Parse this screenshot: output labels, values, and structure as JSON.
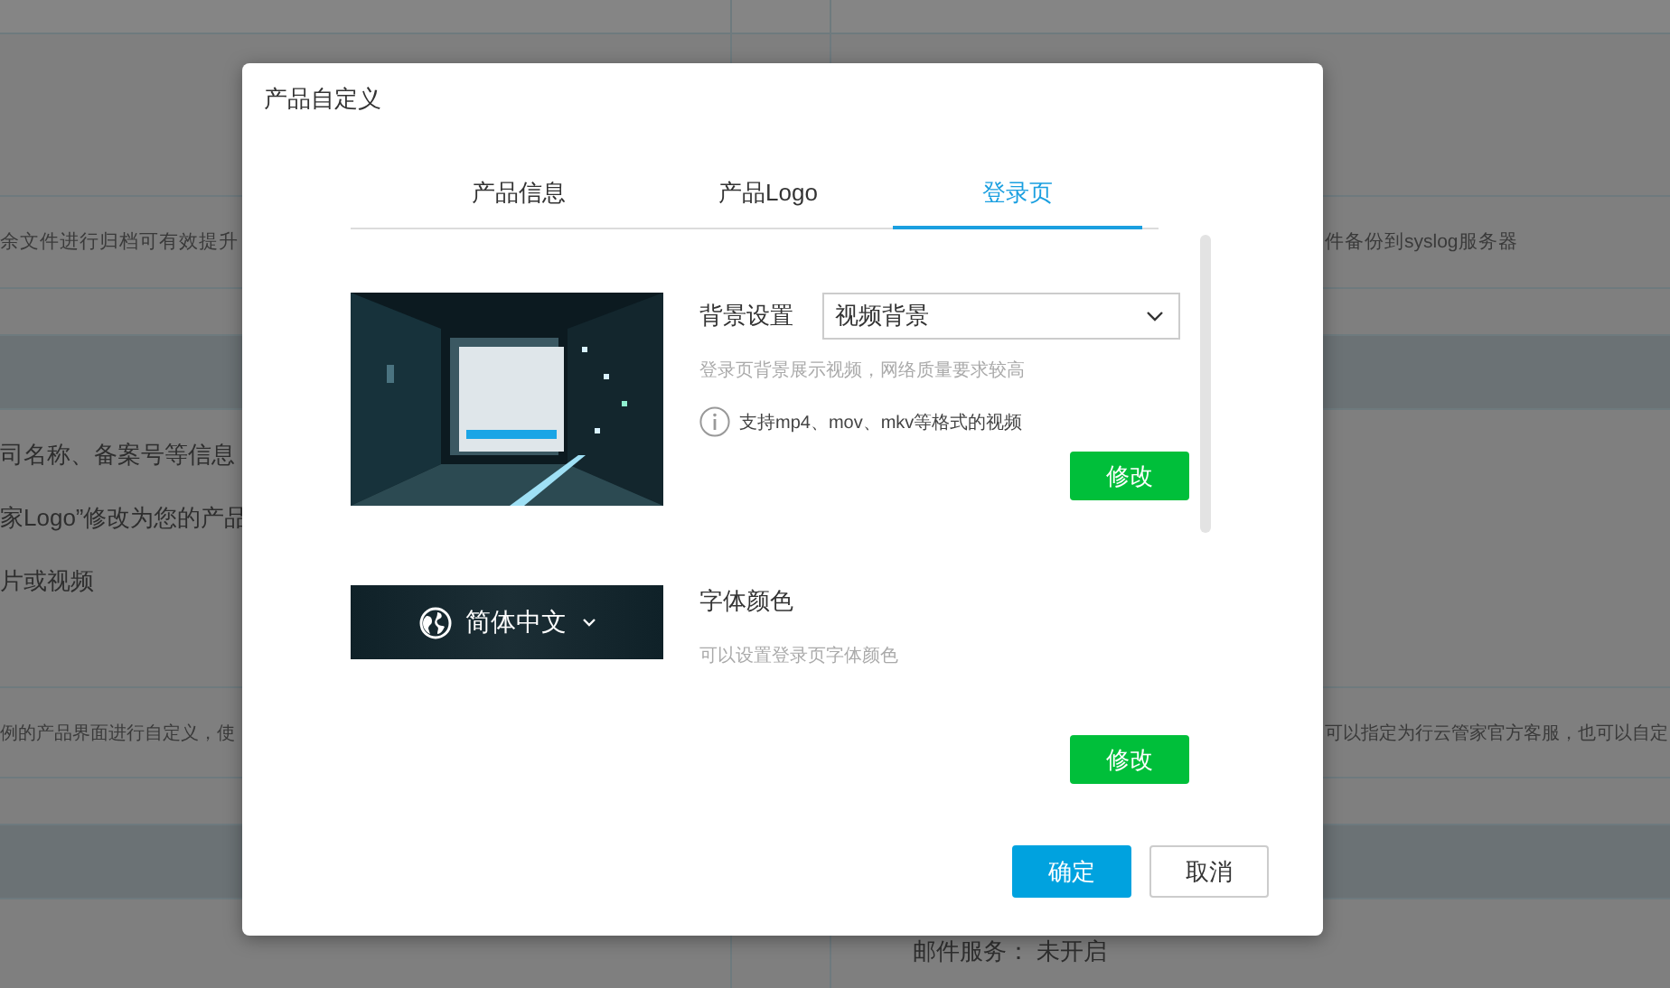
{
  "background": {
    "top_left_text": "余文件进行归档可有效提升",
    "top_right_text": "件备份到syslog服务器",
    "info_lines": [
      "司名称、备案号等信息",
      "家Logo”修改为您的产品",
      "片或视频"
    ],
    "mid_left_text": "例的产品界面进行自定义，使",
    "mid_right_text": "可以指定为行云管家官方客服，也可以自定",
    "bottom_text": "邮件服务：  未开启"
  },
  "dialog": {
    "title": "产品自定义",
    "tabs": [
      {
        "label": "产品信息",
        "selected": false
      },
      {
        "label": "产品Logo",
        "selected": false
      },
      {
        "label": "登录页",
        "selected": true
      }
    ],
    "sections": [
      {
        "kind": "video",
        "label": "背景设置",
        "select_value": "视频背景",
        "hint": "登录页背景展示视频，网络质量要求较高",
        "info": "支持mp4、mov、mkv等格式的视频",
        "button": "修改"
      },
      {
        "kind": "font",
        "preview": {
          "language": "简体中文"
        },
        "label": "字体颜色",
        "hint": "可以设置登录页字体颜色",
        "button": "修改"
      }
    ],
    "buttons": [
      {
        "label": "确定",
        "kind": "primary"
      },
      {
        "label": "取消",
        "kind": "default"
      }
    ]
  }
}
